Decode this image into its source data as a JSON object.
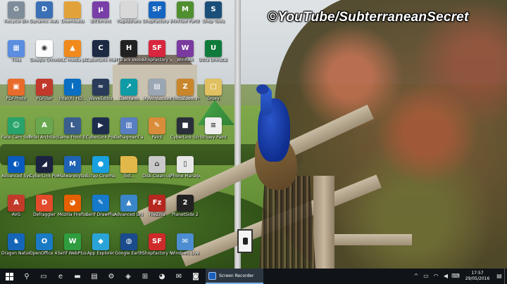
{
  "watermark": "©YouTube/SubterraneanSecret",
  "desktop_icons": [
    {
      "label": "Recycle Bin",
      "icon": "recycle-bin-icon",
      "color": "#7f8c99",
      "glyph": "♻"
    },
    {
      "label": "Dynamic Auto-Publi...",
      "icon": "dynamic-auto-publish-icon",
      "color": "#3b6fb6",
      "glyph": "D"
    },
    {
      "label": "Downloads",
      "icon": "folder-icon",
      "color": "#e2a23a",
      "glyph": ""
    },
    {
      "label": "BitTorrent",
      "icon": "bittorrent-icon",
      "color": "#7a3ea8",
      "glyph": "µ"
    },
    {
      "label": "Rapidshare",
      "icon": "document-icon",
      "color": "#d8d8d8",
      "glyph": ""
    },
    {
      "label": "ShopFactory V10",
      "icon": "shopfactory-icon",
      "color": "#1565c0",
      "glyph": "SF"
    },
    {
      "label": "MiniTool Partition ...",
      "icon": "minitool-icon",
      "color": "#4f8f2f",
      "glyph": "M"
    },
    {
      "label": "Shop Tools",
      "icon": "shoptools-icon",
      "color": "#1a4f7a",
      "glyph": "S"
    },
    {
      "label": "Tiles",
      "icon": "tiles-icon",
      "color": "#5b8de0",
      "glyph": "▦"
    },
    {
      "label": "Google Chrome",
      "icon": "chrome-icon",
      "color": "#fbfbfb",
      "glyph": "◉"
    },
    {
      "label": "VLC media player",
      "icon": "vlc-icon",
      "color": "#f08a1c",
      "glyph": "▲"
    },
    {
      "label": "CyberLink MediaEspre...",
      "icon": "cyberlink-icon",
      "color": "#1d2a44",
      "glyph": "C"
    },
    {
      "label": "HTTrack Website...",
      "icon": "httrack-icon",
      "color": "#222",
      "glyph": "H"
    },
    {
      "label": "ShopFactory V11",
      "icon": "shopfactory-icon",
      "color": "#d7263d",
      "glyph": "SF"
    },
    {
      "label": "WinRAR",
      "icon": "winrar-icon",
      "color": "#7b3aa0",
      "glyph": "W"
    },
    {
      "label": "Ultra Uninstaller",
      "icon": "uninstaller-icon",
      "color": "#0f7a3a",
      "glyph": "U"
    },
    {
      "label": "PDFPhoto",
      "icon": "pdfphoto-icon",
      "color": "#e86b2a",
      "glyph": "▣"
    },
    {
      "label": "PDFiller",
      "icon": "pdf-icon",
      "color": "#c0392b",
      "glyph": "P"
    },
    {
      "label": "Intel(R) HD...",
      "icon": "intel-icon",
      "color": "#0a6fc2",
      "glyph": "i"
    },
    {
      "label": "WaveEditor",
      "icon": "waveeditor-icon",
      "color": "#2a3b5a",
      "glyph": "≈"
    },
    {
      "label": "Dashlane",
      "icon": "dashlane-icon",
      "color": "#0e9ba5",
      "glyph": "↗"
    },
    {
      "label": "MyWinLocker",
      "icon": "mywinlocker-icon",
      "color": "#9aa6b3",
      "glyph": "▤"
    },
    {
      "label": "PhotoZoom Pro 6",
      "icon": "photozoom-icon",
      "color": "#c9862a",
      "glyph": "Z"
    },
    {
      "label": "Droxy",
      "icon": "droxy-icon",
      "color": "#e0c060",
      "glyph": "▢"
    },
    {
      "label": "Face Cam Software",
      "icon": "facecam-icon",
      "color": "#27a36b",
      "glyph": "☺"
    },
    {
      "label": "Intel Architect",
      "icon": "architect-icon",
      "color": "#6aa84f",
      "glyph": "A"
    },
    {
      "label": "Lame Front-End",
      "icon": "lame-icon",
      "color": "#3a5f8f",
      "glyph": "L"
    },
    {
      "label": "CyberLink PowerDire...",
      "icon": "powerdirector-icon",
      "color": "#1f2d4d",
      "glyph": "▶"
    },
    {
      "label": "Defragment and Optimi...",
      "icon": "defragment-icon",
      "color": "#5a7ec2",
      "glyph": "▥"
    },
    {
      "label": "Paint",
      "icon": "paint-icon",
      "color": "#d98c3a",
      "glyph": "✎"
    },
    {
      "label": "CyberLink Screen...",
      "icon": "screen-icon",
      "color": "#2a2f3a",
      "glyph": "■"
    },
    {
      "label": "Stripey Paint",
      "icon": "stripey-icon",
      "color": "#efefef",
      "glyph": "≡"
    },
    {
      "label": "Advanced SystemCare 9",
      "icon": "systemcare-icon",
      "color": "#0a5bbf",
      "glyph": "◐"
    },
    {
      "label": "CyberLink PowerDVD 14",
      "icon": "powerdvd-icon",
      "color": "#1b2340",
      "glyph": "◢"
    },
    {
      "label": "Malwarebytes Anti-Malware",
      "icon": "malwarebytes-icon",
      "color": "#1f63b5",
      "glyph": "M"
    },
    {
      "label": "Scrap Cinema...",
      "icon": "scrap-icon",
      "color": "#19a0e0",
      "glyph": "●"
    },
    {
      "label": "Tod...",
      "icon": "folder-icon",
      "color": "#e2b84a",
      "glyph": ""
    },
    {
      "label": "Disk Clean-up",
      "icon": "diskcleanup-icon",
      "color": "#c9c9c9",
      "glyph": "⌂"
    },
    {
      "label": "Phone Manager",
      "icon": "phone-manager-icon",
      "color": "#e8e8e8",
      "glyph": "▯"
    },
    {
      "label": "AVG",
      "icon": "avg-icon",
      "color": "#c23b2a",
      "glyph": "A"
    },
    {
      "label": "Defraggler",
      "icon": "defraggler-icon",
      "color": "#e24b2b",
      "glyph": "D"
    },
    {
      "label": "Mozilla Firefox",
      "icon": "firefox-icon",
      "color": "#e66000",
      "glyph": "◕"
    },
    {
      "label": "Serif DrawPlus X8",
      "icon": "drawplus-icon",
      "color": "#1679c9",
      "glyph": "✎"
    },
    {
      "label": "Advanced Uninstall...",
      "icon": "advanced-uninstall-icon",
      "color": "#3a86c8",
      "glyph": "▲"
    },
    {
      "label": "FileZilla",
      "icon": "filezilla-icon",
      "color": "#b5271f",
      "glyph": "Fz"
    },
    {
      "label": "PlanetSide 2",
      "icon": "planetside-icon",
      "color": "#222",
      "glyph": "2"
    },
    {
      "label": "Dragon NaturallyS...",
      "icon": "dragon-icon",
      "color": "#1566b8",
      "glyph": "♞"
    },
    {
      "label": "OpenOffice 4.1.1",
      "icon": "openoffice-icon",
      "color": "#1a7bc4",
      "glyph": "O"
    },
    {
      "label": "Serif WebPlus X8",
      "icon": "webplus-icon",
      "color": "#2f9d3f",
      "glyph": "W"
    },
    {
      "label": "App Explorer",
      "icon": "app-explorer-icon",
      "color": "#2aa4d6",
      "glyph": "◆"
    },
    {
      "label": "Google Earth",
      "icon": "google-earth-icon",
      "color": "#1a4b8c",
      "glyph": "◍"
    },
    {
      "label": "ShopFactory V9",
      "icon": "shopfactory-icon",
      "color": "#cf2a2a",
      "glyph": "SF"
    },
    {
      "label": "Windows Live Mail",
      "icon": "live-mail-icon",
      "color": "#4c8ed1",
      "glyph": "✉"
    }
  ],
  "taskbar": {
    "active_app": "Screen Recorder",
    "pinned": [
      {
        "name": "search-icon",
        "glyph": "⚲"
      },
      {
        "name": "task-view-icon",
        "glyph": "▭"
      },
      {
        "name": "edge-icon",
        "glyph": "e"
      },
      {
        "name": "file-explorer-icon",
        "glyph": "▬"
      },
      {
        "name": "folder-icon",
        "glyph": "▤"
      },
      {
        "name": "settings-icon",
        "glyph": "⚙"
      },
      {
        "name": "network-icon",
        "glyph": "◈"
      },
      {
        "name": "store-icon",
        "glyph": "⊞"
      },
      {
        "name": "firefox-icon",
        "glyph": "◕"
      },
      {
        "name": "mail-icon",
        "glyph": "✉"
      },
      {
        "name": "camera-icon",
        "glyph": "◙"
      }
    ],
    "tray_icons": [
      {
        "name": "tray-overflow-icon",
        "glyph": "^"
      },
      {
        "name": "battery-icon",
        "glyph": "▭"
      },
      {
        "name": "wifi-icon",
        "glyph": "◠"
      },
      {
        "name": "volume-icon",
        "glyph": "◀"
      },
      {
        "name": "keyboard-icon",
        "glyph": "⌨"
      }
    ],
    "time": "17:57",
    "date": "29/05/2016",
    "notification_icon": "▤"
  }
}
